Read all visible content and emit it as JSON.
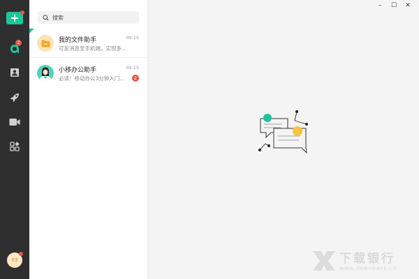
{
  "sidebar": {
    "add_label": "+",
    "nav_badges": {
      "messages": "2"
    },
    "me_avatar_text": "03"
  },
  "search": {
    "placeholder": "搜索"
  },
  "conversations": [
    {
      "title": "我的文件助手",
      "preview": "可发消息至手机端，实现多...",
      "time": "09:15",
      "pinned": true
    },
    {
      "title": "小移办公助手",
      "preview": "必读！移动办公3分钟入门...",
      "time": "09:15",
      "unread": "2"
    }
  ],
  "window_controls": {
    "minimize": "–",
    "maximize": "☐",
    "close": "✕"
  },
  "watermark": {
    "brand": "下载银行",
    "url": "www.downbank.cn"
  },
  "colors": {
    "accent": "#1fc39c",
    "sidebar": "#2f2f2f",
    "badge": "#e8564a",
    "yellow": "#f6c342"
  },
  "icons": [
    "add-icon",
    "messages-icon",
    "contacts-icon",
    "rocket-icon",
    "video-icon",
    "apps-icon",
    "search-icon",
    "folder-icon"
  ]
}
